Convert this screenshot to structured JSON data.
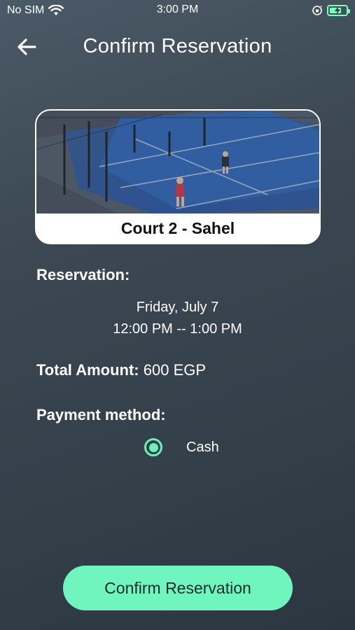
{
  "status_bar": {
    "carrier": "No SIM",
    "time": "3:00 PM"
  },
  "header": {
    "title": "Confirm Reservation"
  },
  "court": {
    "name": "Court 2 - Sahel",
    "image_icon": "court-photo",
    "court_color": "#2f63b5"
  },
  "reservation": {
    "label": "Reservation:",
    "date": "Friday, July 7",
    "time_range": "12:00 PM -- 1:00 PM"
  },
  "total": {
    "label": "Total Amount:",
    "value": "600 EGP"
  },
  "payment": {
    "label": "Payment method:",
    "options": [
      {
        "label": "Cash",
        "selected": true
      }
    ]
  },
  "actions": {
    "confirm_label": "Confirm Reservation"
  },
  "colors": {
    "accent": "#6ff5bd",
    "background_top": "#4a5a66",
    "background_bottom": "#2c3640"
  }
}
